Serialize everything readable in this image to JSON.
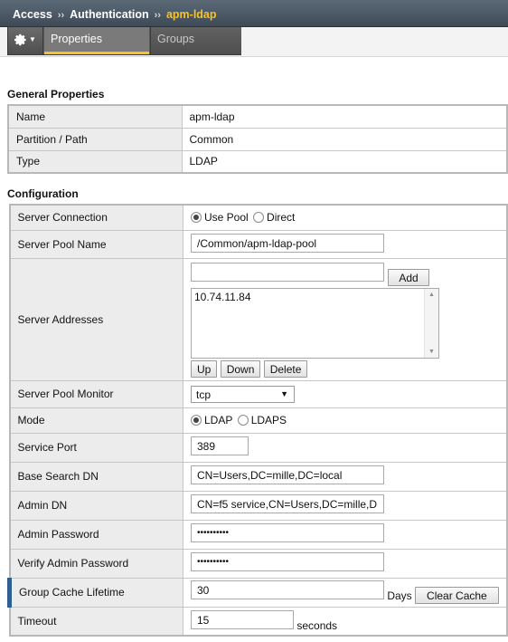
{
  "breadcrumb": {
    "items": [
      "Access",
      "Authentication"
    ],
    "current": "apm-ldap"
  },
  "tabs": [
    {
      "label": "Properties"
    },
    {
      "label": "Groups"
    }
  ],
  "general": {
    "title": "General Properties",
    "rows": [
      {
        "label": "Name",
        "value": "apm-ldap"
      },
      {
        "label": "Partition / Path",
        "value": "Common"
      },
      {
        "label": "Type",
        "value": "LDAP"
      }
    ]
  },
  "config": {
    "title": "Configuration",
    "server_connection": {
      "label": "Server Connection",
      "options": [
        "Use Pool",
        "Direct"
      ],
      "selected": "Use Pool"
    },
    "server_pool_name": {
      "label": "Server Pool Name",
      "value": "/Common/apm-ldap-pool"
    },
    "server_addresses": {
      "label": "Server Addresses",
      "input_value": "",
      "add_label": "Add",
      "list": [
        "10.74.11.84"
      ],
      "up_label": "Up",
      "down_label": "Down",
      "delete_label": "Delete"
    },
    "server_pool_monitor": {
      "label": "Server Pool Monitor",
      "value": "tcp"
    },
    "mode": {
      "label": "Mode",
      "options": [
        "LDAP",
        "LDAPS"
      ],
      "selected": "LDAP"
    },
    "service_port": {
      "label": "Service Port",
      "value": "389"
    },
    "base_search_dn": {
      "label": "Base Search DN",
      "value": "CN=Users,DC=mille,DC=local"
    },
    "admin_dn": {
      "label": "Admin DN",
      "value": "CN=f5 service,CN=Users,DC=mille,D"
    },
    "admin_password": {
      "label": "Admin Password",
      "value": "••••••••••"
    },
    "verify_admin_password": {
      "label": "Verify Admin Password",
      "value": "••••••••••"
    },
    "group_cache_lifetime": {
      "label": "Group Cache Lifetime",
      "value": "30",
      "unit": "Days",
      "clear_label": "Clear Cache"
    },
    "timeout": {
      "label": "Timeout",
      "value": "15",
      "unit": "seconds"
    }
  }
}
